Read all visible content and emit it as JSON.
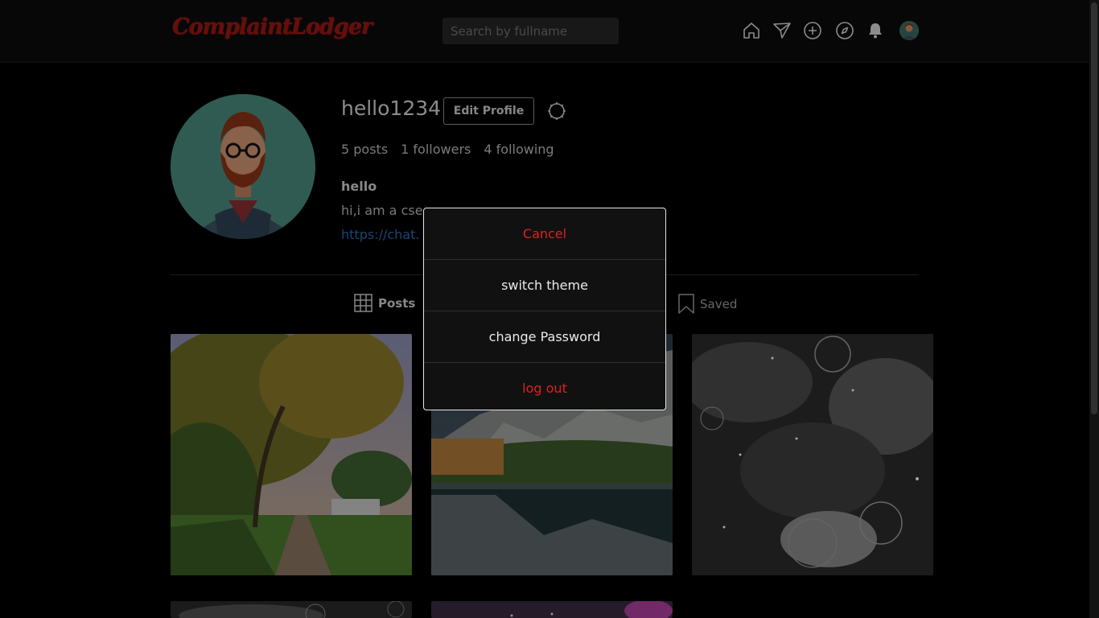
{
  "header": {
    "logo_text": "ComplaintLodger",
    "search_placeholder": "Search by fullname",
    "icons": [
      "home-icon",
      "send-icon",
      "add-post-icon",
      "explore-icon",
      "notifications-icon"
    ]
  },
  "profile": {
    "username": "hello1234",
    "edit_button_label": "Edit Profile",
    "stats": {
      "posts": "5 posts",
      "followers": "1 followers",
      "following": "4 following"
    },
    "bio_name": "hello",
    "bio_text": "hi,i am a cse",
    "bio_link": "https://chat."
  },
  "tabs": {
    "posts_label": "Posts",
    "saved_label": "Saved"
  },
  "modal": {
    "items": [
      {
        "label": "Cancel",
        "style": "danger"
      },
      {
        "label": "switch theme",
        "style": "normal"
      },
      {
        "label": "change Password",
        "style": "normal"
      },
      {
        "label": "log out",
        "style": "danger"
      }
    ]
  },
  "colors": {
    "background": "#000000",
    "header_bg": "#0b0b0b",
    "logo": "#9c1612",
    "link": "#2a6ab0",
    "danger": "#e02020",
    "modal_border": "#e6e6e6"
  }
}
